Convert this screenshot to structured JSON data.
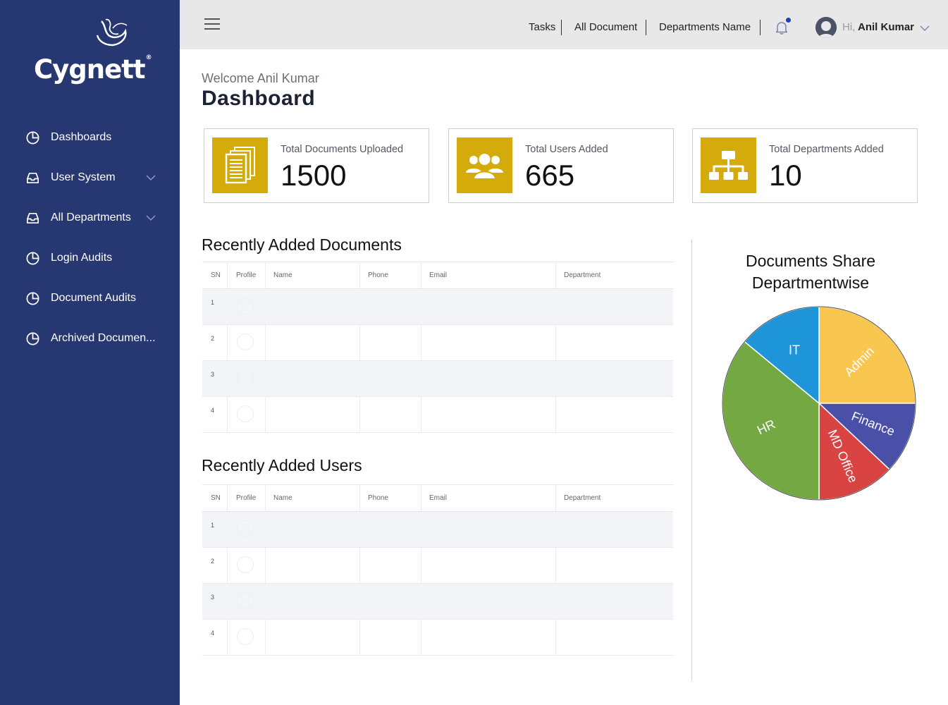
{
  "sidebar": {
    "logo_text": "Cygnett",
    "items": [
      {
        "label": "Dashboards",
        "icon": "pie-chart-icon",
        "has_chevron": false
      },
      {
        "label": "User System",
        "icon": "inbox-icon",
        "has_chevron": true
      },
      {
        "label": "All Departments",
        "icon": "inbox-icon",
        "has_chevron": true
      },
      {
        "label": "Login Audits",
        "icon": "pie-chart-icon",
        "has_chevron": false
      },
      {
        "label": "Document Audits",
        "icon": "pie-chart-icon",
        "has_chevron": false
      },
      {
        "label": "Archived Documen...",
        "icon": "pie-chart-icon",
        "has_chevron": false
      }
    ]
  },
  "header": {
    "links": [
      "Tasks",
      "All Document",
      "Departments Name"
    ],
    "greeting": "Hi,",
    "user_name": "Anil Kumar"
  },
  "main": {
    "welcome": "Welcome Anil Kumar",
    "title": "Dashboard",
    "cards": [
      {
        "label": "Total Documents Uploaded",
        "value": "1500",
        "icon": "documents-icon"
      },
      {
        "label": "Total Users Added",
        "value": "665",
        "icon": "users-icon"
      },
      {
        "label": "Total Departments Added",
        "value": "10",
        "icon": "org-chart-icon"
      }
    ],
    "recent_documents": {
      "title": "Recently Added Documents",
      "columns": [
        "SN",
        "Profile",
        "Name",
        "Phone",
        "Email",
        "Department"
      ],
      "rows": [
        "1",
        "2",
        "3",
        "4"
      ]
    },
    "recent_users": {
      "title": "Recently Added Users",
      "columns": [
        "SN",
        "Profile",
        "Name",
        "Phone",
        "Email",
        "Department"
      ],
      "rows": [
        "1",
        "2",
        "3",
        "4"
      ]
    }
  },
  "colors": {
    "sidebar": "#273771",
    "accent_gold": "#d4ab0a",
    "topbar": "#e8e8e8"
  },
  "chart_data": {
    "type": "pie",
    "title_lines": [
      "Documents Share",
      "Departmentwise"
    ],
    "series": [
      {
        "label": "Admin",
        "value": 25,
        "color": "#f9c74f"
      },
      {
        "label": "Finance",
        "value": 12,
        "color": "#4a4fa7"
      },
      {
        "label": "MD Office",
        "value": 13,
        "color": "#d94341"
      },
      {
        "label": "HR",
        "value": 36,
        "color": "#74a843"
      },
      {
        "label": "IT",
        "value": 14,
        "color": "#1e95d8"
      }
    ]
  }
}
